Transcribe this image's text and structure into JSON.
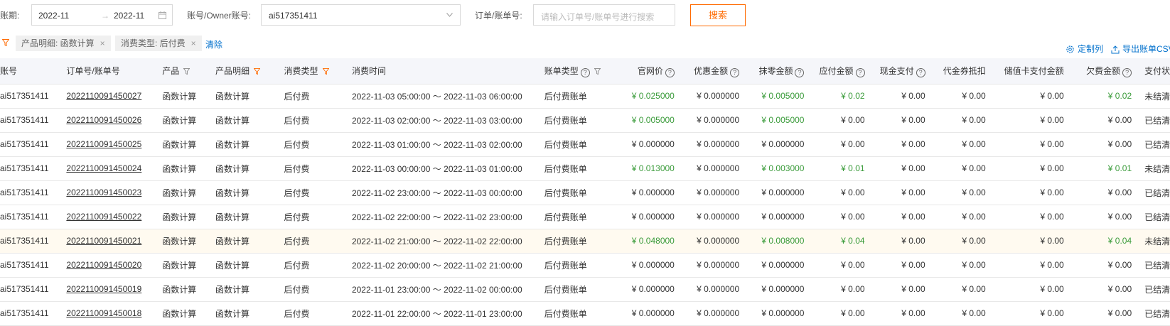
{
  "filters": {
    "period_label": "账期:",
    "period_start": "2022-11",
    "period_sep": "→",
    "period_end": "2022-11",
    "account_label": "账号/Owner账号:",
    "account_value": "ai517351411",
    "order_label": "订单/账单号:",
    "order_placeholder": "请输入订单号/账单号进行搜索",
    "search_label": "搜索"
  },
  "tags": {
    "tag1": "产品明细: 函数计算",
    "tag2": "消费类型: 后付费",
    "close": "×",
    "clear": "清除"
  },
  "toolbar": {
    "customize_label": "定制列",
    "export_label": "导出账单CSV"
  },
  "columns": [
    "账号",
    "订单号/账单号",
    "产品",
    "产品明细",
    "消费类型",
    "消费时间",
    "账单类型",
    "官网价",
    "优惠金额",
    "抹零金额",
    "应付金额",
    "现金支付",
    "代金券抵扣",
    "储值卡支付金额",
    "欠费金额",
    "支付状态"
  ],
  "rows": [
    {
      "account": "ai517351411",
      "order": "2022110091450027",
      "product": "函数计算",
      "detail": "函数计算",
      "type": "后付费",
      "time": "2022-11-03 05:00:00 ～ 2022-11-03 06:00:00",
      "bill_type": "后付费账单",
      "list_price": "¥ 0.025000",
      "discount": "¥ 0.000000",
      "rounding": "¥ 0.005000",
      "payable": "¥ 0.02",
      "cash": "¥ 0.00",
      "coupon": "¥ 0.00",
      "card": "¥ 0.00",
      "owed": "¥ 0.02",
      "status": "未结清"
    },
    {
      "account": "ai517351411",
      "order": "2022110091450026",
      "product": "函数计算",
      "detail": "函数计算",
      "type": "后付费",
      "time": "2022-11-03 02:00:00 ～ 2022-11-03 03:00:00",
      "bill_type": "后付费账单",
      "list_price": "¥ 0.005000",
      "discount": "¥ 0.000000",
      "rounding": "¥ 0.005000",
      "payable": "¥ 0.00",
      "cash": "¥ 0.00",
      "coupon": "¥ 0.00",
      "card": "¥ 0.00",
      "owed": "¥ 0.00",
      "status": "已结清"
    },
    {
      "account": "ai517351411",
      "order": "2022110091450025",
      "product": "函数计算",
      "detail": "函数计算",
      "type": "后付费",
      "time": "2022-11-03 01:00:00 ～ 2022-11-03 02:00:00",
      "bill_type": "后付费账单",
      "list_price": "¥ 0.000000",
      "discount": "¥ 0.000000",
      "rounding": "¥ 0.000000",
      "payable": "¥ 0.00",
      "cash": "¥ 0.00",
      "coupon": "¥ 0.00",
      "card": "¥ 0.00",
      "owed": "¥ 0.00",
      "status": "已结清"
    },
    {
      "account": "ai517351411",
      "order": "2022110091450024",
      "product": "函数计算",
      "detail": "函数计算",
      "type": "后付费",
      "time": "2022-11-03 00:00:00 ～ 2022-11-03 01:00:00",
      "bill_type": "后付费账单",
      "list_price": "¥ 0.013000",
      "discount": "¥ 0.000000",
      "rounding": "¥ 0.003000",
      "payable": "¥ 0.01",
      "cash": "¥ 0.00",
      "coupon": "¥ 0.00",
      "card": "¥ 0.00",
      "owed": "¥ 0.01",
      "status": "未结清"
    },
    {
      "account": "ai517351411",
      "order": "2022110091450023",
      "product": "函数计算",
      "detail": "函数计算",
      "type": "后付费",
      "time": "2022-11-02 23:00:00 ～ 2022-11-03 00:00:00",
      "bill_type": "后付费账单",
      "list_price": "¥ 0.000000",
      "discount": "¥ 0.000000",
      "rounding": "¥ 0.000000",
      "payable": "¥ 0.00",
      "cash": "¥ 0.00",
      "coupon": "¥ 0.00",
      "card": "¥ 0.00",
      "owed": "¥ 0.00",
      "status": "已结清"
    },
    {
      "account": "ai517351411",
      "order": "2022110091450022",
      "product": "函数计算",
      "detail": "函数计算",
      "type": "后付费",
      "time": "2022-11-02 22:00:00 ～ 2022-11-02 23:00:00",
      "bill_type": "后付费账单",
      "list_price": "¥ 0.000000",
      "discount": "¥ 0.000000",
      "rounding": "¥ 0.000000",
      "payable": "¥ 0.00",
      "cash": "¥ 0.00",
      "coupon": "¥ 0.00",
      "card": "¥ 0.00",
      "owed": "¥ 0.00",
      "status": "已结清"
    },
    {
      "account": "ai517351411",
      "order": "2022110091450021",
      "product": "函数计算",
      "detail": "函数计算",
      "type": "后付费",
      "time": "2022-11-02 21:00:00 ～ 2022-11-02 22:00:00",
      "bill_type": "后付费账单",
      "list_price": "¥ 0.048000",
      "discount": "¥ 0.000000",
      "rounding": "¥ 0.008000",
      "payable": "¥ 0.04",
      "cash": "¥ 0.00",
      "coupon": "¥ 0.00",
      "card": "¥ 0.00",
      "owed": "¥ 0.04",
      "status": "未结清"
    },
    {
      "account": "ai517351411",
      "order": "2022110091450020",
      "product": "函数计算",
      "detail": "函数计算",
      "type": "后付费",
      "time": "2022-11-02 20:00:00 ～ 2022-11-02 21:00:00",
      "bill_type": "后付费账单",
      "list_price": "¥ 0.000000",
      "discount": "¥ 0.000000",
      "rounding": "¥ 0.000000",
      "payable": "¥ 0.00",
      "cash": "¥ 0.00",
      "coupon": "¥ 0.00",
      "card": "¥ 0.00",
      "owed": "¥ 0.00",
      "status": "已结清"
    },
    {
      "account": "ai517351411",
      "order": "2022110091450019",
      "product": "函数计算",
      "detail": "函数计算",
      "type": "后付费",
      "time": "2022-11-01 23:00:00 ～ 2022-11-02 00:00:00",
      "bill_type": "后付费账单",
      "list_price": "¥ 0.000000",
      "discount": "¥ 0.000000",
      "rounding": "¥ 0.000000",
      "payable": "¥ 0.00",
      "cash": "¥ 0.00",
      "coupon": "¥ 0.00",
      "card": "¥ 0.00",
      "owed": "¥ 0.00",
      "status": "已结清"
    },
    {
      "account": "ai517351411",
      "order": "2022110091450018",
      "product": "函数计算",
      "detail": "函数计算",
      "type": "后付费",
      "time": "2022-11-01 22:00:00 ～ 2022-11-01 23:00:00",
      "bill_type": "后付费账单",
      "list_price": "¥ 0.000000",
      "discount": "¥ 0.000000",
      "rounding": "¥ 0.000000",
      "payable": "¥ 0.00",
      "cash": "¥ 0.00",
      "coupon": "¥ 0.00",
      "card": "¥ 0.00",
      "owed": "¥ 0.00",
      "status": "已结清"
    }
  ],
  "colors": {
    "accent": "#ff6a00",
    "link": "#0070cc",
    "positive": "#3a9b3a",
    "highlight_row": "#fffaf0"
  }
}
